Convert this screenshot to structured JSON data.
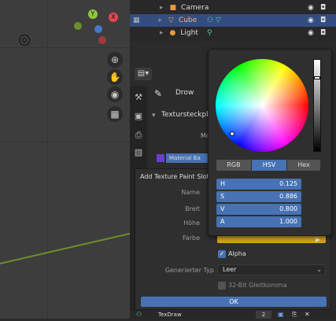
{
  "outliner": {
    "rows": [
      {
        "label": "Camera"
      },
      {
        "label": "Cube"
      },
      {
        "label": "Light"
      }
    ]
  },
  "gizmo": {
    "y_label": "Y",
    "x_label": "X"
  },
  "props": {
    "tool_label": "Drow",
    "texture_slots_header": "Textursteckpl",
    "mode_label": "Mo",
    "material_label": "Material Ba"
  },
  "dialog": {
    "title": "Add Texture Paint Slot",
    "name_label": "Name",
    "width_label": "Breit",
    "height_label": "Höhe",
    "color_label": "Farbe",
    "alpha_label": "Alpha",
    "generated_type_label": "Generierter Typ",
    "generated_type_value": "Leer",
    "float_label": "32-Bit Gleitkomma",
    "ok_label": "OK",
    "color_value": "#d2a419"
  },
  "picker": {
    "modes": [
      "RGB",
      "HSV",
      "Hex"
    ],
    "active_mode": "HSV",
    "fields": [
      {
        "name": "H",
        "value": "0.125"
      },
      {
        "name": "S",
        "value": "0.886"
      },
      {
        "name": "V",
        "value": "0.800"
      },
      {
        "name": "A",
        "value": "1.000"
      }
    ]
  },
  "bottom": {
    "texdraw_label": "TexDraw",
    "count": "2"
  }
}
